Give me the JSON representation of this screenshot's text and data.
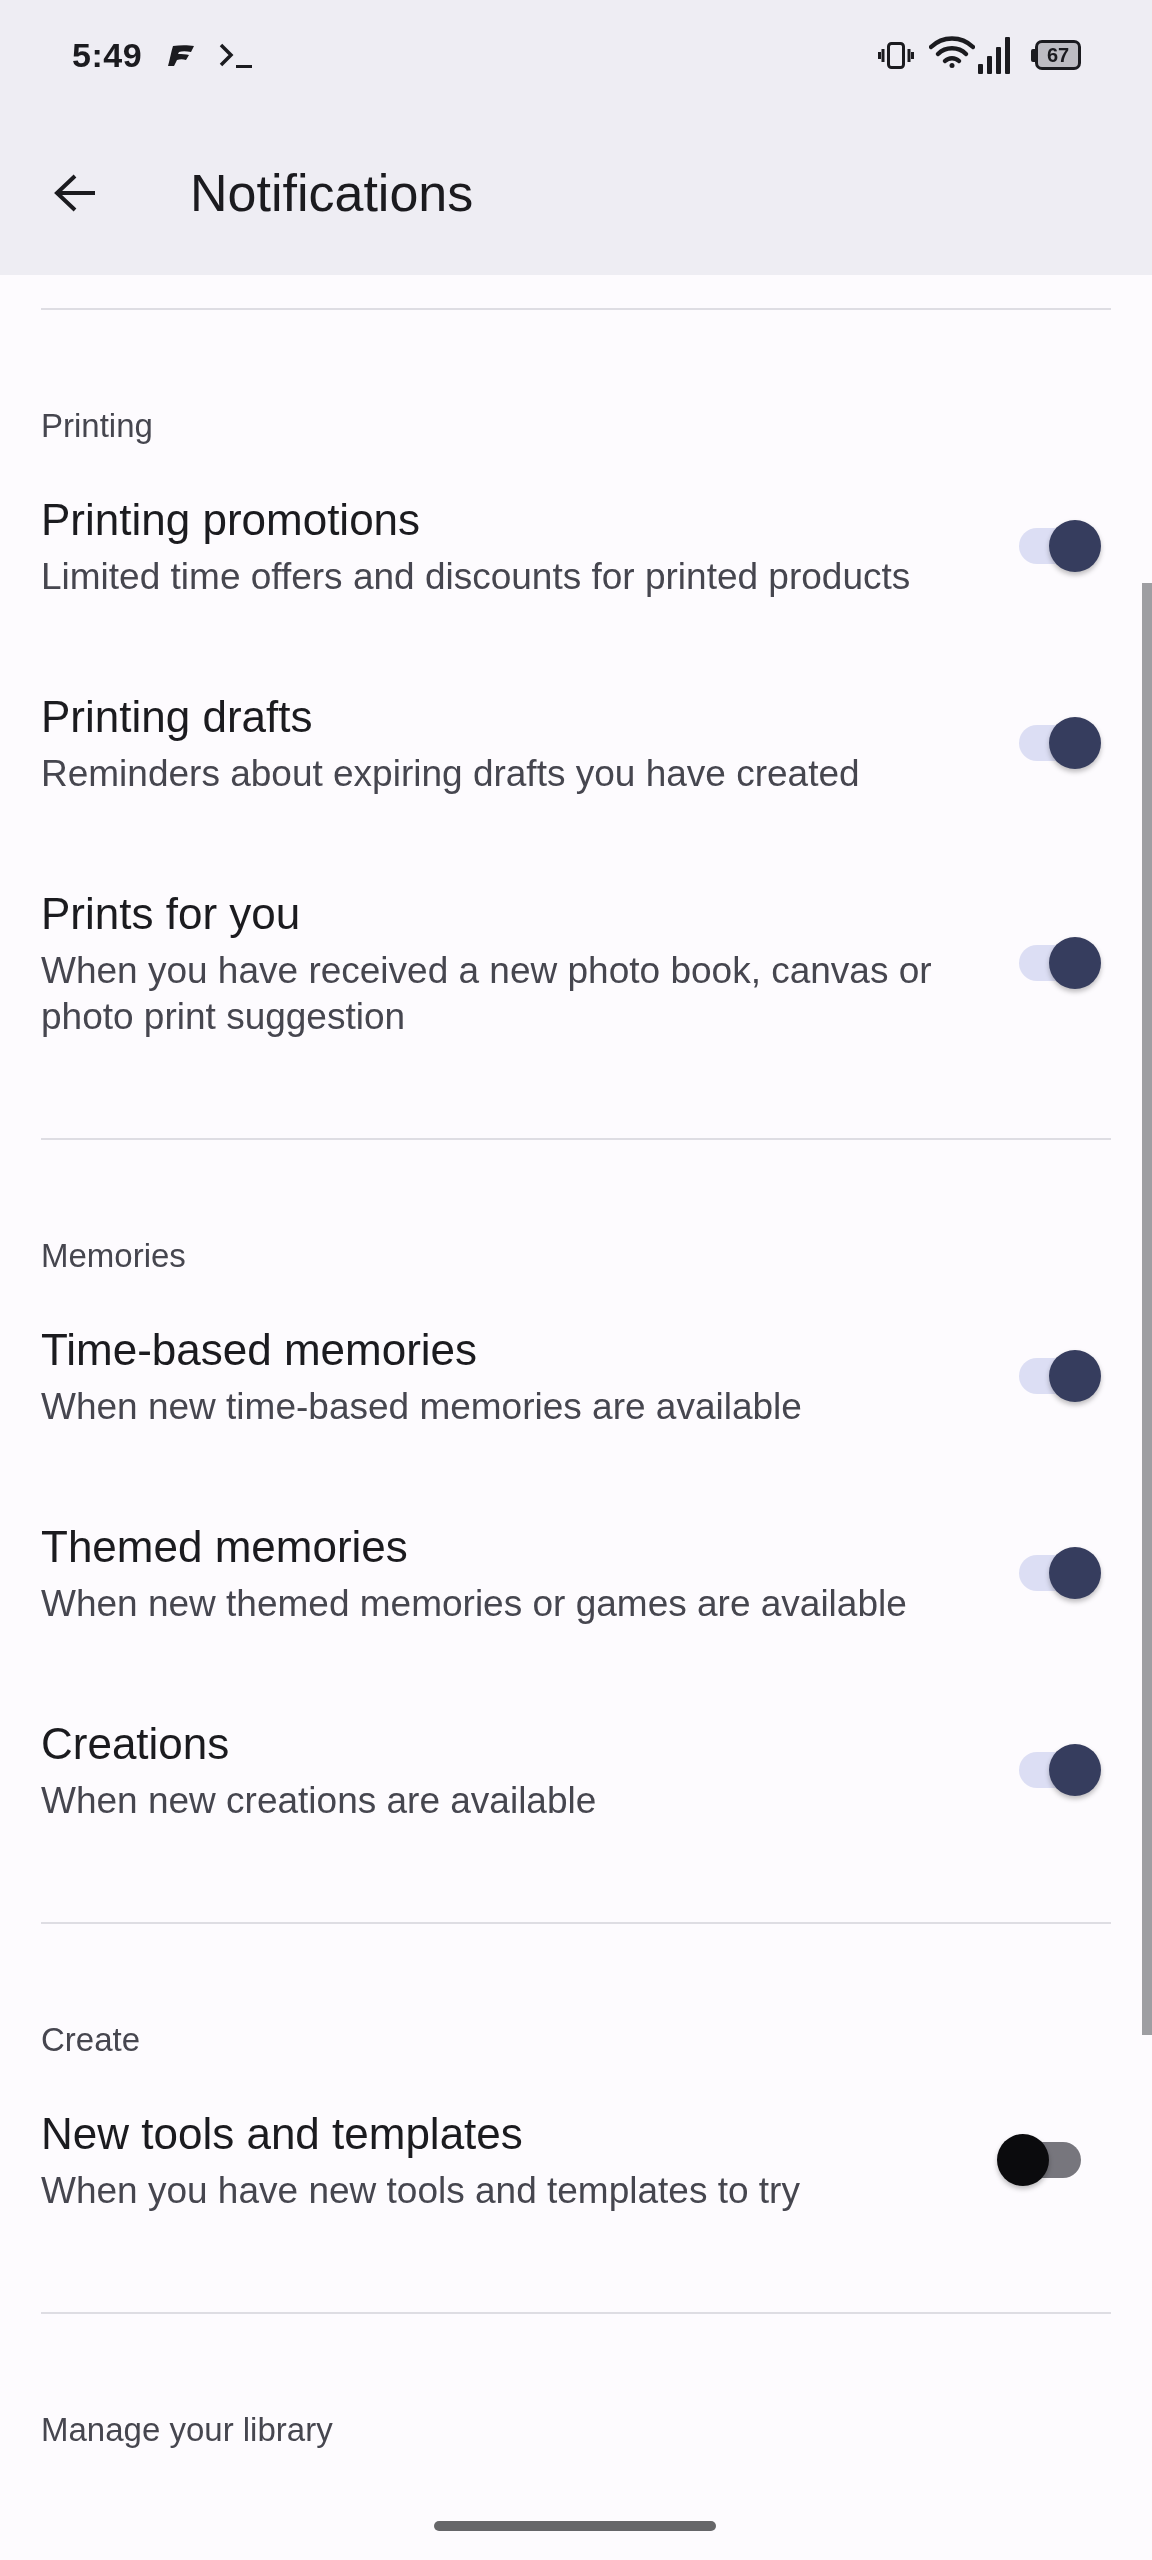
{
  "status_bar": {
    "time": "5:49",
    "battery": "67"
  },
  "app_bar": {
    "title": "Notifications"
  },
  "sections": [
    {
      "header": "Printing",
      "items": [
        {
          "title": "Printing promotions",
          "subtitle": "Limited time offers and discounts for printed products",
          "on": true
        },
        {
          "title": "Printing drafts",
          "subtitle": "Reminders about expiring drafts you have created",
          "on": true
        },
        {
          "title": "Prints for you",
          "subtitle": "When you have received a new photo book, canvas or photo print suggestion",
          "on": true
        }
      ]
    },
    {
      "header": "Memories",
      "items": [
        {
          "title": "Time-based memories",
          "subtitle": "When new time-based memories are available",
          "on": true
        },
        {
          "title": "Themed memories",
          "subtitle": "When new themed memories or games are available",
          "on": true
        },
        {
          "title": "Creations",
          "subtitle": "When new creations are available",
          "on": true
        }
      ]
    },
    {
      "header": "Create",
      "items": [
        {
          "title": "New tools and templates",
          "subtitle": "When you have new tools and templates to try",
          "on": false
        }
      ]
    },
    {
      "header": "Manage your library"
    }
  ]
}
